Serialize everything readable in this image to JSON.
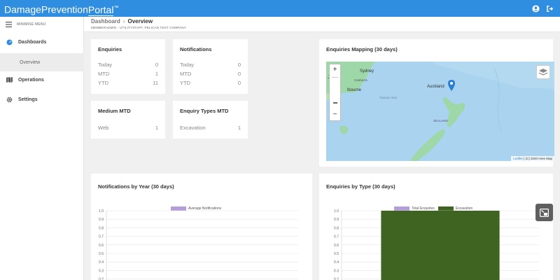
{
  "brand": {
    "part1": "Damage",
    "part2": "Prevention",
    "part3": "Portal",
    "tm": "™"
  },
  "topbar": {
    "user_icon": "user-circle-icon",
    "logout_icon": "sign-out-icon"
  },
  "sidebar": {
    "minimise_label": "MINIMISE MENU",
    "items": [
      {
        "label": "Dashboards",
        "icon": "dashboard-gauge-icon"
      },
      {
        "label": "Overview"
      },
      {
        "label": "Operations",
        "icon": "map-icon"
      },
      {
        "label": "Settings",
        "icon": "gear-icon"
      }
    ]
  },
  "breadcrumb": {
    "parent": "Dashboard",
    "separator": "›",
    "current": "Overview",
    "member": "MEMBERADMIN - UTILITYSTAFF, PELICAN TEST COMPANY"
  },
  "cards": {
    "enquiries": {
      "title": "Enquiries",
      "rows": [
        {
          "label": "Today",
          "value": "0"
        },
        {
          "label": "MTD",
          "value": "1"
        },
        {
          "label": "YTD",
          "value": "11"
        }
      ]
    },
    "notifications": {
      "title": "Notifications",
      "rows": [
        {
          "label": "Today",
          "value": "0"
        },
        {
          "label": "MTD",
          "value": "0"
        },
        {
          "label": "YTD",
          "value": "0"
        }
      ]
    },
    "medium": {
      "title": "Medium MTD",
      "rows": [
        {
          "label": "Web",
          "value": "1"
        }
      ]
    },
    "enquiry_types": {
      "title": "Enquiry Types MTD",
      "rows": [
        {
          "label": "Excavation",
          "value": "1"
        }
      ]
    }
  },
  "map": {
    "title": "Enquiries Mapping (30 days)",
    "zoom_in": "+",
    "zoom_out": "−",
    "labels": {
      "sydney": "Sydney",
      "canberra": "Canberra",
      "melbourne": "lbourne",
      "auckland": "Auckland",
      "tasman": "Tasman Sea",
      "zealand": "ZEALAND",
      "edge": "Je"
    },
    "attribution_link": "Leaflet",
    "attribution_text": " | (C) 2020 Here Map",
    "colors": {
      "water": "#aad3f0",
      "land": "#9ed7a8",
      "marker": "#2a7fd4"
    }
  },
  "chart_notifications": {
    "title": "Notifications by Year (30 days)",
    "chart_data": {
      "type": "bar",
      "title": "",
      "series": [
        {
          "name": "Average Notifications",
          "values": []
        }
      ],
      "categories": [],
      "ylim": [
        0,
        1
      ],
      "yticks": [
        "1.0",
        "0.9",
        "0.8",
        "0.7",
        "0.6",
        "0.5",
        "0.4",
        "0.3",
        "0.2",
        "0.1"
      ],
      "legend": "top-center",
      "grid": true,
      "colors": {
        "Average Notifications": "#b39ddb"
      }
    }
  },
  "chart_enquiries_type": {
    "title": "Enquiries by Type (30 days)",
    "chart_data": {
      "type": "bar",
      "title": "",
      "series": [
        {
          "name": "Total Enquiries",
          "values": []
        },
        {
          "name": "Excavation",
          "values": [
            1
          ]
        }
      ],
      "categories": [
        ""
      ],
      "ylim": [
        0,
        1
      ],
      "yticks": [
        "1.0",
        "0.9",
        "0.8",
        "0.7",
        "0.6",
        "0.5",
        "0.4",
        "0.3",
        "0.2",
        "0.1"
      ],
      "legend": "top-center",
      "grid": true,
      "colors": {
        "Total Enquiries": "#b39ddb",
        "Excavation": "#3f6421"
      }
    }
  },
  "float_button": {
    "icon": "export-screen-icon"
  }
}
